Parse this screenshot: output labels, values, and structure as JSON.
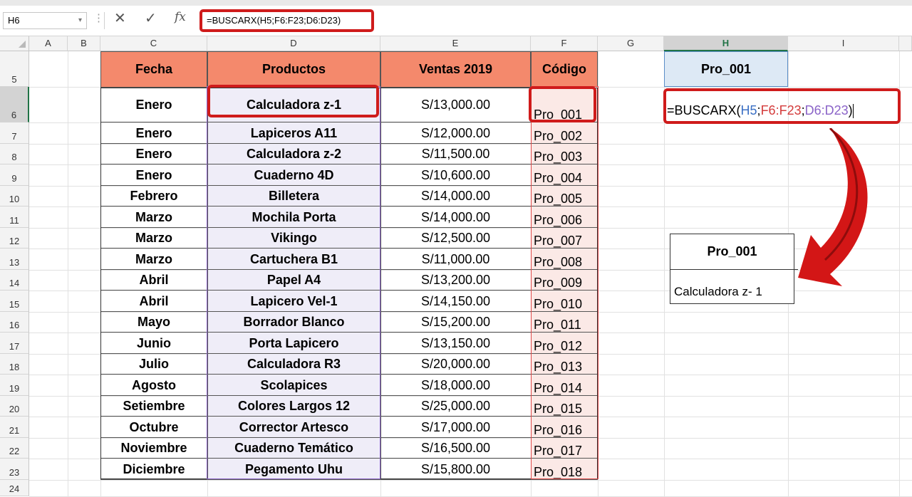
{
  "formula_bar": {
    "name_box": "H6",
    "cancel_icon": "✕",
    "enter_icon": "✓",
    "fx_label": "fx",
    "formula": "=BUSCARX(H5;F6:F23;D6:D23)"
  },
  "columns": [
    "A",
    "B",
    "C",
    "D",
    "E",
    "F",
    "G",
    "H",
    "I"
  ],
  "rows": [
    "5",
    "6",
    "7",
    "8",
    "9",
    "10",
    "11",
    "12",
    "13",
    "14",
    "15",
    "16",
    "17",
    "18",
    "19",
    "20",
    "21",
    "22",
    "23",
    "24"
  ],
  "table": {
    "headers": {
      "fecha": "Fecha",
      "productos": "Productos",
      "ventas": "Ventas 2019",
      "codigo": "Código"
    },
    "rows": [
      {
        "fecha": "Enero",
        "producto": "Calculadora z-1",
        "venta": "S/13,000.00",
        "codigo": "Pro_001"
      },
      {
        "fecha": "Enero",
        "producto": "Lapiceros A11",
        "venta": "S/12,000.00",
        "codigo": "Pro_002"
      },
      {
        "fecha": "Enero",
        "producto": "Calculadora z-2",
        "venta": "S/11,500.00",
        "codigo": "Pro_003"
      },
      {
        "fecha": "Enero",
        "producto": "Cuaderno 4D",
        "venta": "S/10,600.00",
        "codigo": "Pro_004"
      },
      {
        "fecha": "Febrero",
        "producto": "Billetera",
        "venta": "S/14,000.00",
        "codigo": "Pro_005"
      },
      {
        "fecha": "Marzo",
        "producto": "Mochila Porta",
        "venta": "S/14,000.00",
        "codigo": "Pro_006"
      },
      {
        "fecha": "Marzo",
        "producto": "Vikingo",
        "venta": "S/12,500.00",
        "codigo": "Pro_007"
      },
      {
        "fecha": "Marzo",
        "producto": "Cartuchera B1",
        "venta": "S/11,000.00",
        "codigo": "Pro_008"
      },
      {
        "fecha": "Abril",
        "producto": "Papel A4",
        "venta": "S/13,200.00",
        "codigo": "Pro_009"
      },
      {
        "fecha": "Abril",
        "producto": "Lapicero Vel-1",
        "venta": "S/14,150.00",
        "codigo": "Pro_010"
      },
      {
        "fecha": "Mayo",
        "producto": "Borrador Blanco",
        "venta": "S/15,200.00",
        "codigo": "Pro_011"
      },
      {
        "fecha": "Junio",
        "producto": "Porta Lapicero",
        "venta": "S/13,150.00",
        "codigo": "Pro_012"
      },
      {
        "fecha": "Julio",
        "producto": "Calculadora R3",
        "venta": "S/20,000.00",
        "codigo": "Pro_013"
      },
      {
        "fecha": "Agosto",
        "producto": "Scolapices",
        "venta": "S/18,000.00",
        "codigo": "Pro_014"
      },
      {
        "fecha": "Setiembre",
        "producto": "Colores Largos 12",
        "venta": "S/25,000.00",
        "codigo": "Pro_015"
      },
      {
        "fecha": "Octubre",
        "producto": "Corrector Artesco",
        "venta": "S/17,000.00",
        "codigo": "Pro_016"
      },
      {
        "fecha": "Noviembre",
        "producto": "Cuaderno Temático",
        "venta": "S/16,500.00",
        "codigo": "Pro_017"
      },
      {
        "fecha": "Diciembre",
        "producto": "Pegamento Uhu",
        "venta": "S/15,800.00",
        "codigo": "Pro_018"
      }
    ]
  },
  "lookup": {
    "h5_value": "Pro_001",
    "h6_formula": {
      "prefix": "=BUSCARX(",
      "arg1": "H5",
      "sep1": ";",
      "arg2": "F6:F23",
      "sep2": ";",
      "arg3": "D6:D23",
      "suffix": ")"
    },
    "result_header": "Pro_001",
    "result_value": "Calculadora z- 1"
  },
  "colors": {
    "header_fill": "#f4896c",
    "highlight": "#cf1b1b",
    "arg1": "#3a6fc4",
    "arg2": "#d43b3b",
    "arg3": "#8a63c8"
  }
}
